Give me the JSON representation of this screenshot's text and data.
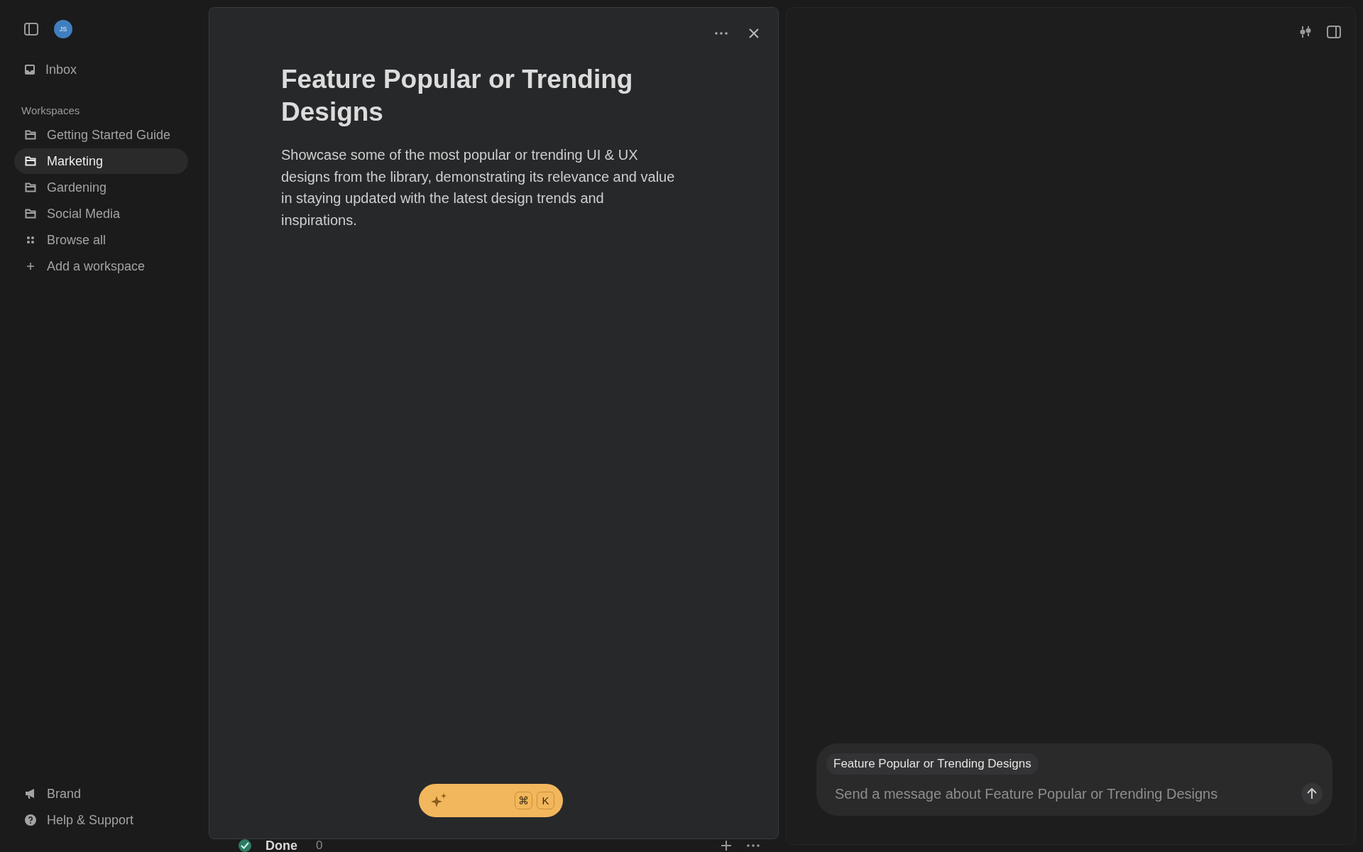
{
  "sidebar": {
    "user": {
      "initials": "JS"
    },
    "inbox": {
      "label": "Inbox"
    },
    "section_label": "Workspaces",
    "items": [
      {
        "kind": "folder",
        "label": "Getting Started Guide",
        "selected": false
      },
      {
        "kind": "folder",
        "label": "Marketing",
        "selected": true
      },
      {
        "kind": "folder",
        "label": "Gardening",
        "selected": false
      },
      {
        "kind": "folder",
        "label": "Social Media",
        "selected": false
      },
      {
        "kind": "grid",
        "label": "Browse all",
        "selected": false
      },
      {
        "kind": "add",
        "label": "Add a workspace",
        "selected": false
      }
    ],
    "footer": [
      {
        "kind": "megaphone",
        "label": "Brand"
      },
      {
        "kind": "help",
        "label": "Help & Support"
      }
    ]
  },
  "board_row": {
    "label": "Done",
    "count": "0"
  },
  "document": {
    "title": "Feature Popular or Trending Designs",
    "body": "Showcase some of the most popular or trending UI & UX designs from the library, demonstrating its relevance and value in staying updated with the latest design trends and inspirations."
  },
  "ai_bar": {
    "keys": [
      "⌘",
      "K"
    ]
  },
  "chat": {
    "context_chip": "Feature Popular or Trending Designs",
    "placeholder": "Send a message about Feature Popular or Trending Designs"
  }
}
